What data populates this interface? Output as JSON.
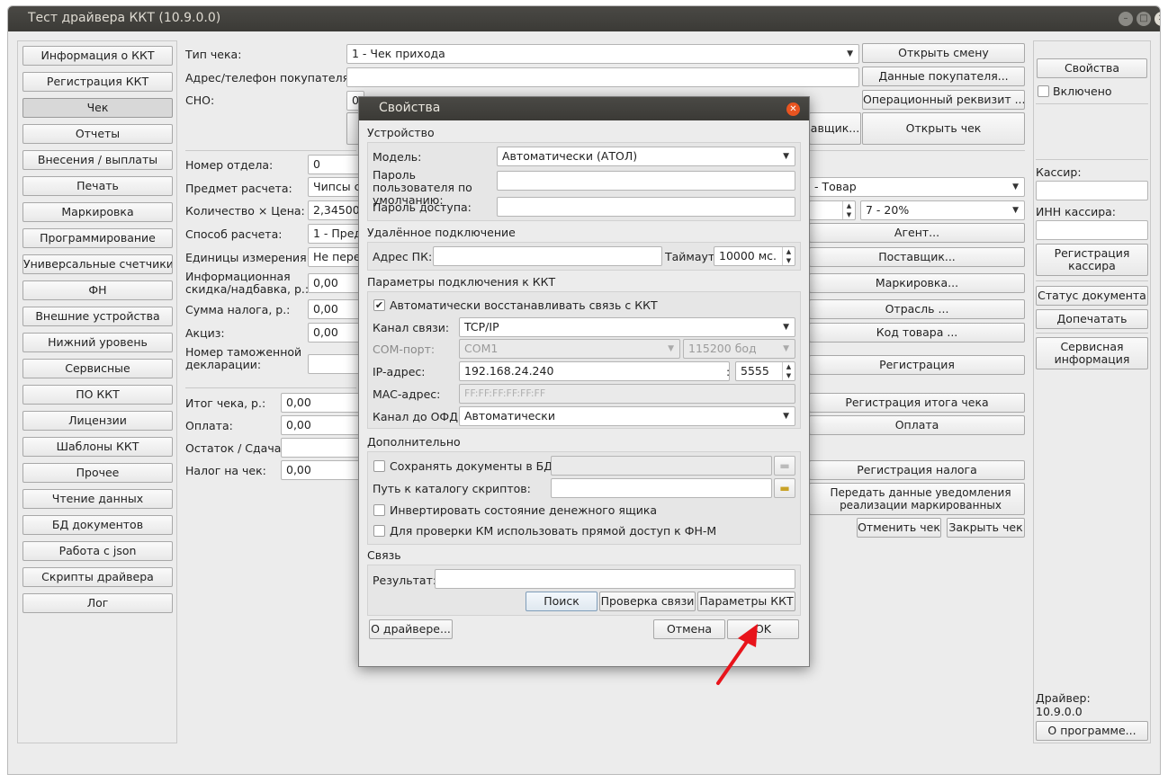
{
  "window": {
    "title": "Тест драйвера ККТ (10.9.0.0)"
  },
  "sidebar": {
    "items": [
      {
        "label": "Информация о ККТ"
      },
      {
        "label": "Регистрация ККТ"
      },
      {
        "label": "Чек",
        "selected": true
      },
      {
        "label": "Отчеты"
      },
      {
        "label": "Внесения / выплаты"
      },
      {
        "label": "Печать"
      },
      {
        "label": "Маркировка"
      },
      {
        "label": "Программирование"
      },
      {
        "label": "Универсальные счетчики"
      },
      {
        "label": "ФН"
      },
      {
        "label": "Внешние устройства"
      },
      {
        "label": "Нижний уровень"
      },
      {
        "label": "Сервисные"
      },
      {
        "label": "ПО ККТ"
      },
      {
        "label": "Лицензии"
      },
      {
        "label": "Шаблоны ККТ"
      },
      {
        "label": "Прочее"
      },
      {
        "label": "Чтение данных"
      },
      {
        "label": "БД документов"
      },
      {
        "label": "Работа с json"
      },
      {
        "label": "Скрипты драйвера"
      },
      {
        "label": "Лог"
      }
    ]
  },
  "main": {
    "receipt_type_label": "Тип чека:",
    "receipt_type_value": "1 - Чек прихода",
    "buyer_address_label": "Адрес/телефон покупателя:",
    "sno_label": "СНО:",
    "sno_value": "0",
    "open_shift": "Открыть смену",
    "buyer_data": "Данные покупателя...",
    "operational_req": "Операционный реквизит ...",
    "supplier_partial": "авщик...",
    "open_receipt": "Открыть чек",
    "department_label": "Номер отдела:",
    "department_value": "0",
    "subject_label": "Предмет расчета:",
    "subject_value": "Чипсы с",
    "qty_price_label": "Количество × Цена:",
    "qty_value": "2,34500",
    "payment_method_label": "Способ расчета:",
    "payment_method_value": "1 - Пред",
    "units_label": "Единицы измерения:",
    "units_value": "Не перед",
    "discount_label": "Информационная скидка/надбавка, р.:",
    "discount_value": "0,00",
    "tax_sum_label": "Сумма налога, р.:",
    "tax_sum_value": "0,00",
    "excise_label": "Акциз:",
    "excise_value": "0,00",
    "customs_label": "Номер таможенной декларации:",
    "total_label": "Итог чека, р.:",
    "total_value": "0,00",
    "payment_label": "Оплата:",
    "payment_value": "0,00",
    "change_label": "Остаток / Сдача:",
    "tax_label": "Налог на чек:",
    "tax_value": "0,00",
    "subject_type_value": "- Товар",
    "vat_value": "7 - 20%",
    "agent_btn": "Агент...",
    "supplier_btn": "Поставщик...",
    "marking_btn": "Маркировка...",
    "industry_btn": "Отрасль ...",
    "product_code_btn": "Код товара ...",
    "registration_btn": "Регистрация",
    "total_reg_btn": "Регистрация итога чека",
    "payment_btn": "Оплата",
    "tax_reg_btn": "Регистрация налога",
    "send_notice_btn": "Передать данные уведомления реализации маркированных товаров",
    "cancel_receipt_btn": "Отменить чек",
    "close_receipt_btn": "Закрыть чек"
  },
  "right_panel": {
    "properties_btn": "Свойства",
    "enabled_label": "Включено",
    "cashier_label": "Кассир:",
    "cashier_inn_label": "ИНН кассира:",
    "cashier_reg_btn": "Регистрация кассира",
    "doc_status_btn": "Статус документа",
    "reprint_btn": "Допечатать",
    "service_info_btn": "Сервисная информация",
    "driver_label": "Драйвер:",
    "driver_version": "10.9.0.0",
    "about_btn": "О программе..."
  },
  "dialog": {
    "title": "Свойства",
    "device_section": "Устройство",
    "model_label": "Модель:",
    "model_value": "Автоматически (АТОЛ)",
    "default_password_label": "Пароль пользователя по умолчанию:",
    "access_password_label": "Пароль доступа:",
    "remote_section": "Удалённое подключение",
    "pc_address_label": "Адрес ПК:",
    "timeout_label": "Таймаут",
    "timeout_value": "10000 мс.",
    "conn_params_section": "Параметры подключения к ККТ",
    "auto_restore_label": "Автоматически восстанавливать связь с ККТ",
    "channel_label": "Канал связи:",
    "channel_value": "TCP/IP",
    "com_port_label": "COM-порт:",
    "com_port_value": "COM1",
    "baud_value": "115200 бод",
    "ip_label": "IP-адрес:",
    "ip_value": "192.168.24.240",
    "port_value": "5555",
    "mac_label": "MAC-адрес:",
    "mac_placeholder": "FF:FF:FF:FF:FF:FF",
    "ofd_channel_label": "Канал до ОФД:",
    "ofd_channel_value": "Автоматически",
    "extra_section": "Дополнительно",
    "save_docs_label": "Сохранять документы в БД",
    "scripts_path_label": "Путь к каталогу скриптов:",
    "invert_drawer_label": "Инвертировать состояние денежного ящика",
    "km_direct_label": "Для проверки КМ использовать прямой доступ к ФН-М",
    "link_section": "Связь",
    "result_label": "Результат:",
    "search_btn": "Поиск",
    "check_link_btn": "Проверка связи",
    "kkt_params_btn": "Параметры ККТ",
    "about_driver_btn": "О драйвере...",
    "cancel_btn": "Отмена",
    "ok_btn": "OK"
  },
  "colors": {
    "accent": "#e95420",
    "arrow": "#e8141b",
    "titlebar": "#3b3a36"
  }
}
